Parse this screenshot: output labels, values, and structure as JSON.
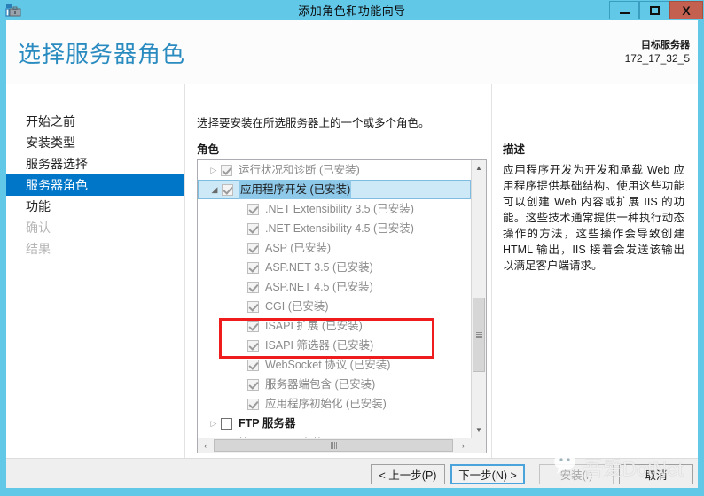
{
  "window": {
    "title": "添加角色和功能向导",
    "app_icon": "server-manager-icon",
    "controls": {
      "minimize": "minimize-icon",
      "maximize": "maximize-icon",
      "close": "X"
    },
    "accent_color": "#62c8e8",
    "close_color": "#c4604f"
  },
  "header": {
    "page_title": "选择服务器角色",
    "target_server_label": "目标服务器",
    "target_server_value": "172_17_32_5",
    "title_color": "#2a8bc0"
  },
  "sidebar": {
    "items": [
      {
        "label": "开始之前",
        "state": "normal"
      },
      {
        "label": "安装类型",
        "state": "normal"
      },
      {
        "label": "服务器选择",
        "state": "normal"
      },
      {
        "label": "服务器角色",
        "state": "selected"
      },
      {
        "label": "功能",
        "state": "normal"
      },
      {
        "label": "确认",
        "state": "disabled"
      },
      {
        "label": "结果",
        "state": "disabled"
      }
    ],
    "selected_color": "#0076c8"
  },
  "main": {
    "instruction": "选择要安装在所选服务器上的一个或多个角色。",
    "roles_label": "角色",
    "tree": [
      {
        "label": "运行状况和诊断 (已安装)",
        "indent": 0,
        "expander": "collapsed",
        "checkbox": "checked",
        "enabled": false,
        "selected": false
      },
      {
        "label": "应用程序开发 (已安装)",
        "indent": 0,
        "expander": "expanded",
        "checkbox": "checked",
        "enabled": false,
        "selected": true
      },
      {
        "label": ".NET Extensibility 3.5 (已安装)",
        "indent": 1,
        "expander": "none",
        "checkbox": "checked",
        "enabled": false,
        "selected": false
      },
      {
        "label": ".NET Extensibility 4.5 (已安装)",
        "indent": 1,
        "expander": "none",
        "checkbox": "checked",
        "enabled": false,
        "selected": false
      },
      {
        "label": "ASP (已安装)",
        "indent": 1,
        "expander": "none",
        "checkbox": "checked",
        "enabled": false,
        "selected": false
      },
      {
        "label": "ASP.NET 3.5 (已安装)",
        "indent": 1,
        "expander": "none",
        "checkbox": "checked",
        "enabled": false,
        "selected": false
      },
      {
        "label": "ASP.NET 4.5 (已安装)",
        "indent": 1,
        "expander": "none",
        "checkbox": "checked",
        "enabled": false,
        "selected": false
      },
      {
        "label": "CGI (已安装)",
        "indent": 1,
        "expander": "none",
        "checkbox": "checked",
        "enabled": false,
        "selected": false
      },
      {
        "label": "ISAPI 扩展 (已安装)",
        "indent": 1,
        "expander": "none",
        "checkbox": "checked",
        "enabled": false,
        "selected": false
      },
      {
        "label": "ISAPI 筛选器 (已安装)",
        "indent": 1,
        "expander": "none",
        "checkbox": "checked",
        "enabled": false,
        "selected": false
      },
      {
        "label": "WebSocket 协议 (已安装)",
        "indent": 1,
        "expander": "none",
        "checkbox": "checked",
        "enabled": false,
        "selected": false
      },
      {
        "label": "服务器端包含 (已安装)",
        "indent": 1,
        "expander": "none",
        "checkbox": "checked",
        "enabled": false,
        "selected": false
      },
      {
        "label": "应用程序初始化 (已安装)",
        "indent": 1,
        "expander": "none",
        "checkbox": "checked",
        "enabled": false,
        "selected": false
      },
      {
        "label": "FTP 服务器",
        "indent": 0,
        "expander": "collapsed",
        "checkbox": "unchecked",
        "enabled": true,
        "selected": false
      },
      {
        "label": "管理工具 (已安装)",
        "indent": 0,
        "expander": "collapsed",
        "checkbox": "checked",
        "enabled": false,
        "selected": false
      }
    ],
    "scrollbar": {
      "up_arrow": "chevron-up-icon",
      "down_arrow": "chevron-down-icon",
      "left_arrow": "chevron-left-icon",
      "right_arrow": "chevron-right-icon"
    },
    "annotation": {
      "color": "#ee1c1c",
      "highlights": [
        "CGI (已安装)",
        "ISAPI 扩展 (已安装)",
        "ISAPI 筛选器 (已安装)"
      ]
    }
  },
  "description": {
    "title": "描述",
    "body": "应用程序开发为开发和承载 Web 应用程序提供基础结构。使用这些功能可以创建 Web 内容或扩展 IIS 的功能。这些技术通常提供一种执行动态操作的方法，这些操作会导致创建 HTML 输出，IIS 接着会发送该输出以满足客户端请求。"
  },
  "footer": {
    "prev": "< 上一步(P)",
    "next": "下一步(N) >",
    "install": "安装(I)",
    "cancel": "取消"
  },
  "watermark": {
    "text": "吾爱DotNet",
    "logo": "wechat-icon"
  }
}
